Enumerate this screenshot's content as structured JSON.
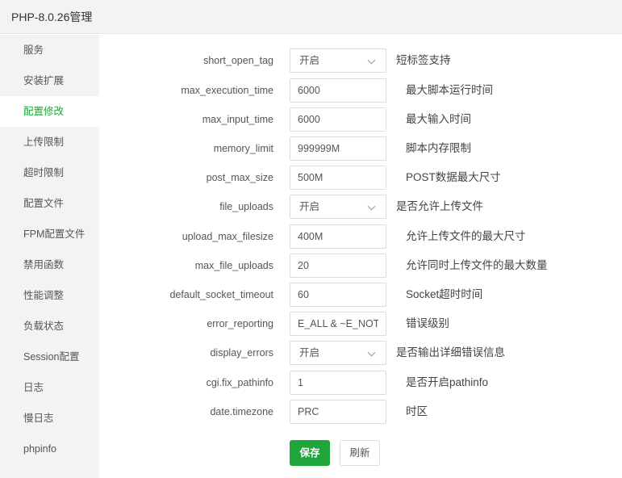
{
  "window": {
    "title": "PHP-8.0.26管理"
  },
  "sidebar": {
    "items": [
      {
        "label": "服务"
      },
      {
        "label": "安装扩展"
      },
      {
        "label": "配置修改",
        "active": true
      },
      {
        "label": "上传限制"
      },
      {
        "label": "超时限制"
      },
      {
        "label": "配置文件"
      },
      {
        "label": "FPM配置文件"
      },
      {
        "label": "禁用函数"
      },
      {
        "label": "性能调整"
      },
      {
        "label": "负载状态"
      },
      {
        "label": "Session配置"
      },
      {
        "label": "日志"
      },
      {
        "label": "慢日志"
      },
      {
        "label": "phpinfo"
      }
    ]
  },
  "config": {
    "fields": [
      {
        "key": "short_open_tag",
        "type": "select",
        "value": "开启",
        "desc": "短标签支持"
      },
      {
        "key": "max_execution_time",
        "type": "input",
        "value": "6000",
        "desc": "最大脚本运行时间"
      },
      {
        "key": "max_input_time",
        "type": "input",
        "value": "6000",
        "desc": "最大输入时间"
      },
      {
        "key": "memory_limit",
        "type": "input",
        "value": "999999M",
        "desc": "脚本内存限制"
      },
      {
        "key": "post_max_size",
        "type": "input",
        "value": "500M",
        "desc": "POST数据最大尺寸"
      },
      {
        "key": "file_uploads",
        "type": "select",
        "value": "开启",
        "desc": "是否允许上传文件"
      },
      {
        "key": "upload_max_filesize",
        "type": "input",
        "value": "400M",
        "desc": "允许上传文件的最大尺寸"
      },
      {
        "key": "max_file_uploads",
        "type": "input",
        "value": "20",
        "desc": "允许同时上传文件的最大数量"
      },
      {
        "key": "default_socket_timeout",
        "type": "input",
        "value": "60",
        "desc": "Socket超时时间"
      },
      {
        "key": "error_reporting",
        "type": "input",
        "value": "E_ALL & ~E_NOTICE",
        "desc": "错误级别"
      },
      {
        "key": "display_errors",
        "type": "select",
        "value": "开启",
        "desc": "是否输出详细错误信息"
      },
      {
        "key": "cgi.fix_pathinfo",
        "type": "input",
        "value": "1",
        "desc": "是否开启pathinfo"
      },
      {
        "key": "date.timezone",
        "type": "input",
        "value": "PRC",
        "desc": "时区"
      }
    ]
  },
  "buttons": {
    "save_label": "保存",
    "refresh_label": "刷新"
  },
  "colors": {
    "accent": "#20a53a",
    "sidebar_bg": "#f3f3f3"
  }
}
